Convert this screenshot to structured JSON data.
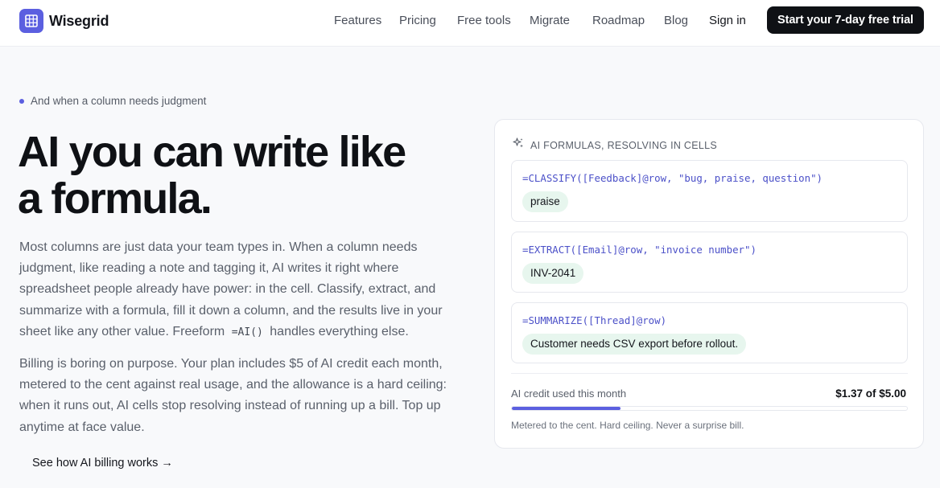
{
  "brand": {
    "name": "Wisegrid",
    "accent": "#5b5fe0"
  },
  "nav": {
    "items": [
      {
        "label": "Features"
      },
      {
        "label": "Pricing"
      },
      {
        "label": "Free tools"
      },
      {
        "label": "Migrate"
      },
      {
        "label": "Roadmap"
      },
      {
        "label": "Blog"
      }
    ],
    "sign_in": "Sign in",
    "cta": "Start your 7-day free trial"
  },
  "hero": {
    "eyebrow": "And when a column needs judgment",
    "title_line1": "AI you can write like",
    "title_line2": "a formula.",
    "para1_before": "Most columns are just data your team types in. When a column needs judgment, like reading a note and tagging it, AI writes it right where spreadsheet people already have power: in the cell. Classify, extract, and summarize with a formula, fill it down a column, and the results live in your sheet like any other value. Freeform ",
    "para1_code": "=AI()",
    "para1_after": " handles everything else.",
    "para2": "Billing is boring on purpose. Your plan includes $5 of AI credit each month, metered to the cent against real usage, and the allowance is a hard ceiling: when it runs out, AI cells stop resolving instead of running up a bill. Top up anytime at face value.",
    "link": "See how AI billing works →"
  },
  "card": {
    "header": "AI FORMULAS, RESOLVING IN CELLS",
    "icon": "sparkle-icon",
    "formulas": [
      {
        "formula": "=CLASSIFY([Feedback]@row, \"bug, praise, question\")",
        "result": "praise"
      },
      {
        "formula": "=EXTRACT([Email]@row, \"invoice number\")",
        "result": "INV-2041"
      },
      {
        "formula": "=SUMMARIZE([Thread]@row)",
        "result": "Customer needs CSV export before rollout."
      }
    ],
    "usage": {
      "label": "AI credit used this month",
      "value": "$1.37 of $5.00",
      "fraction": 0.274,
      "note": "Metered to the cent. Hard ceiling. Never a surprise bill."
    }
  }
}
